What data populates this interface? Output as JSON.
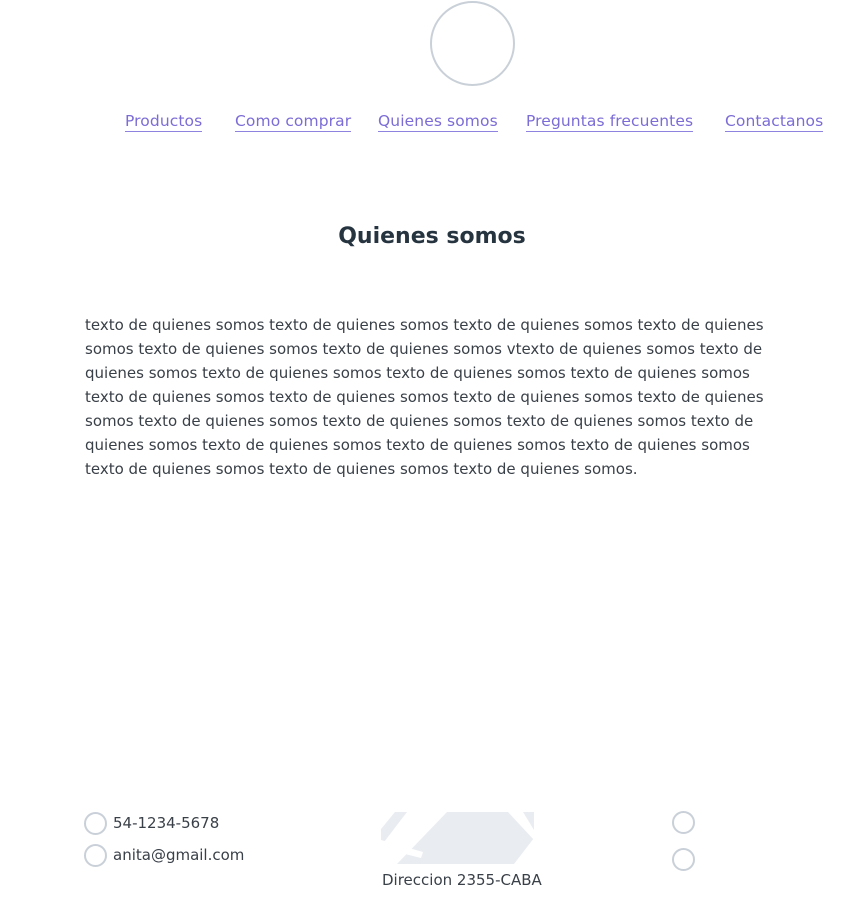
{
  "nav": {
    "items": [
      {
        "label": "Productos"
      },
      {
        "label": "Como comprar"
      },
      {
        "label": "Quienes somos"
      },
      {
        "label": "Preguntas frecuentes"
      },
      {
        "label": "Contactanos"
      }
    ]
  },
  "main": {
    "title": "Quienes somos",
    "text": "texto de quienes somos texto de quienes somos texto de quienes somos texto de quienes somos texto de quienes somos texto de quienes somos vtexto de quienes somos texto de quienes somos texto de quienes somos texto de quienes somos texto de quienes somos texto de quienes somos texto de quienes somos texto de quienes somos texto de quienes somos texto de quienes somos texto de quienes somos texto de quienes somos texto de quienes somos texto de quienes somos texto de quienes somos texto de quienes somos texto de quienes somos texto de quienes somos texto de quienes somos."
  },
  "footer": {
    "phone": "54-1234-5678",
    "email": "anita@gmail.com",
    "address": "Direccion 2355-CABA",
    "icons": {
      "phone": "phone-icon",
      "email": "email-icon",
      "map": "map-icon",
      "social_1": "social-icon",
      "social_2": "social-icon"
    }
  },
  "colors": {
    "link": "#7b6cd6",
    "heading": "#263440",
    "icon_outline": "#c9d0d8",
    "map_fill": "#e9ecf1"
  }
}
